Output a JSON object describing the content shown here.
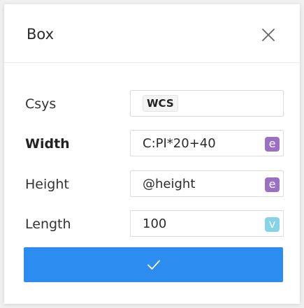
{
  "dialog": {
    "title": "Box",
    "close_icon": "close-icon",
    "confirm_icon": "check-icon"
  },
  "fields": [
    {
      "label": "Csys",
      "value": "WCS",
      "kind": "tag"
    },
    {
      "label": "Width",
      "value": "C:PI*20+40",
      "badge": "e",
      "badge_color": "#9b6fc3"
    },
    {
      "label": "Height",
      "value": "@height",
      "badge": "e",
      "badge_color": "#9b6fc3"
    },
    {
      "label": "Length",
      "value": "100",
      "badge": "v",
      "badge_color": "#86d3e8"
    }
  ],
  "colors": {
    "accent": "#2d8cf0",
    "expression_badge": "#9b6fc3",
    "value_badge": "#86d3e8"
  }
}
